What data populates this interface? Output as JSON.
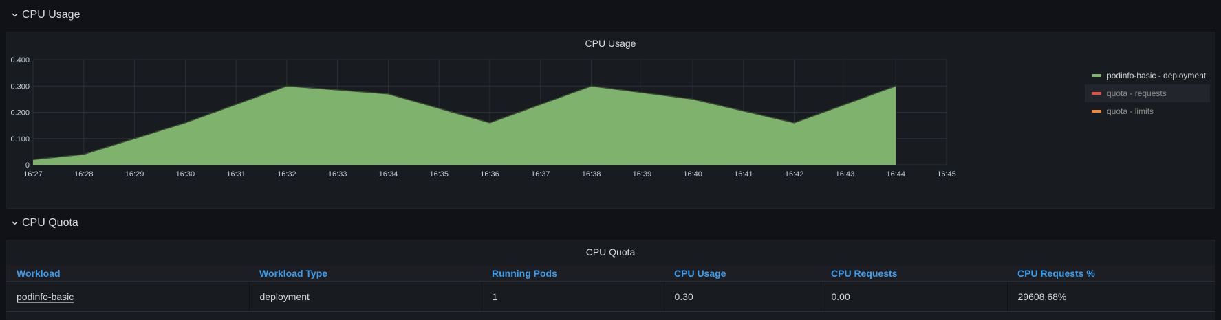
{
  "rows": {
    "usage_title": "CPU Usage",
    "quota_title": "CPU Quota"
  },
  "chart_panel": {
    "title": "CPU Usage"
  },
  "chart_data": {
    "type": "area",
    "title": "CPU Usage",
    "x": [
      "16:27",
      "16:28",
      "16:29",
      "16:30",
      "16:31",
      "16:32",
      "16:33",
      "16:34",
      "16:35",
      "16:36",
      "16:37",
      "16:38",
      "16:39",
      "16:40",
      "16:41",
      "16:42",
      "16:43",
      "16:44"
    ],
    "x_ticks": [
      "16:27",
      "16:28",
      "16:29",
      "16:30",
      "16:31",
      "16:32",
      "16:33",
      "16:34",
      "16:35",
      "16:36",
      "16:37",
      "16:38",
      "16:39",
      "16:40",
      "16:41",
      "16:42",
      "16:43",
      "16:44",
      "16:45"
    ],
    "y_ticks": [
      "0",
      "0.100",
      "0.200",
      "0.300",
      "0.400"
    ],
    "ylim": [
      0,
      0.4
    ],
    "grid": true,
    "legend_position": "right",
    "series": [
      {
        "name": "podinfo-basic - deployment",
        "color": "#7eb26d",
        "values": [
          0.02,
          0.04,
          0.1,
          0.16,
          0.23,
          0.3,
          0.285,
          0.27,
          0.215,
          0.16,
          0.23,
          0.3,
          0.275,
          0.25,
          0.205,
          0.16,
          0.23,
          0.3
        ]
      },
      {
        "name": "quota - requests",
        "color": "#e24d42",
        "values": []
      },
      {
        "name": "quota - limits",
        "color": "#ef843c",
        "values": []
      }
    ]
  },
  "legend": [
    {
      "label": "podinfo-basic - deployment",
      "color": "#7eb26d"
    },
    {
      "label": "quota - requests",
      "color": "#e24d42"
    },
    {
      "label": "quota - limits",
      "color": "#ef843c"
    }
  ],
  "table_panel": {
    "title": "CPU Quota",
    "headers": [
      "Workload",
      "Workload Type",
      "Running Pods",
      "CPU Usage",
      "CPU Requests",
      "CPU Requests %"
    ],
    "rows": [
      [
        "podinfo-basic",
        "deployment",
        "1",
        "0.30",
        "0.00",
        "29608.68%"
      ]
    ]
  }
}
